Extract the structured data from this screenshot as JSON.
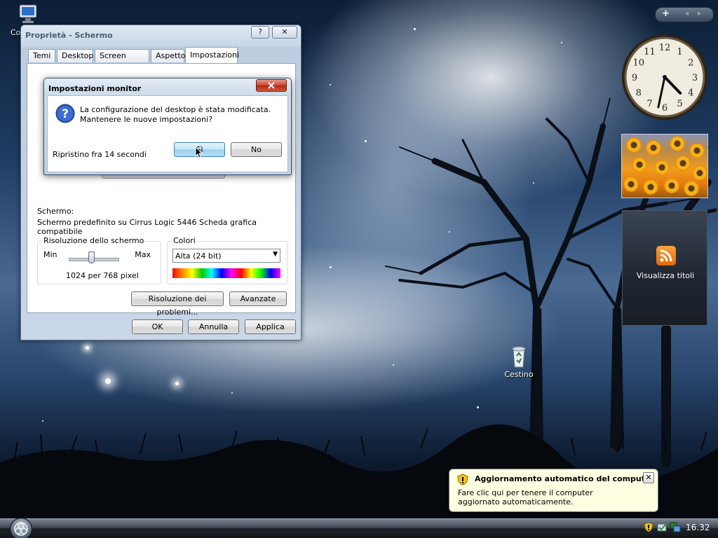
{
  "desktop": {
    "icons": [
      {
        "label": "Co"
      },
      {
        "label": "Cestino"
      }
    ]
  },
  "sidebar": {
    "controls": {
      "add": "+",
      "prev": "◂",
      "next": "▸"
    },
    "clock": {
      "hour": 4,
      "minute": 32
    },
    "feed": {
      "label": "Visualizza titoli"
    }
  },
  "window": {
    "title": "Proprietà - Schermo",
    "help_button": "?",
    "close_button": "✕",
    "tabs": [
      "Temi",
      "Desktop",
      "Screen saver",
      "Aspetto",
      "Impostazioni"
    ],
    "active_tab": "Impostazioni",
    "display_label": "Schermo:",
    "display_value": "Schermo predefinito su Cirrus Logic 5446 Scheda grafica compatibile",
    "resolution": {
      "legend": "Risoluzione dello schermo",
      "min": "Min",
      "max": "Max",
      "value": "1024 per 768 pixel",
      "slider_position": 0.45
    },
    "colors": {
      "legend": "Colori",
      "selected": "Alta (24 bit)"
    },
    "buttons": {
      "troubleshoot": "Risoluzione dei problemi...",
      "advanced": "Avanzate",
      "ok": "OK",
      "cancel": "Annulla",
      "apply": "Applica"
    }
  },
  "dialog": {
    "title": "Impostazioni monitor",
    "message_line1": "La configurazione del desktop è stata modificata.",
    "message_line2": "Mantenere le nuove impostazioni?",
    "countdown": "Ripristino fra 14 secondi",
    "yes": "Sì",
    "no": "No"
  },
  "balloon": {
    "title": "Aggiornamento automatico del computer",
    "body": "Fare clic qui per tenere il computer aggiornato automaticamente.",
    "close": "✕"
  },
  "taskbar": {
    "time": "16.32"
  }
}
